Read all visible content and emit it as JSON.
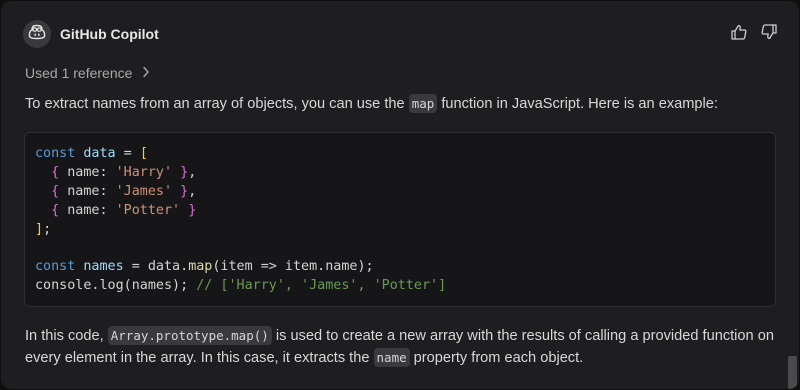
{
  "header": {
    "title": "GitHub Copilot",
    "avatar_icon": "copilot-icon",
    "actions": [
      {
        "name": "thumbs-up-icon"
      },
      {
        "name": "thumbs-down-icon"
      }
    ]
  },
  "reference": {
    "label": "Used 1 reference",
    "icon": "chevron-right-icon"
  },
  "message": {
    "intro_before": "To extract names from an array of objects, you can use the ",
    "intro_code": "map",
    "intro_after": " function in JavaScript. Here is an example:",
    "code": {
      "l1_kw": "const",
      "l1_var": "data",
      "l1_op": " = ",
      "l1_open": "[",
      "l2_open": "{",
      "l2_key": " name: ",
      "l2_str": "'Harry'",
      "l2_close": "}",
      "l2_comma": ",",
      "l3_open": "{",
      "l3_key": " name: ",
      "l3_str": "'James'",
      "l3_close": "}",
      "l3_comma": ",",
      "l4_open": "{",
      "l4_key": " name: ",
      "l4_str": "'Potter'",
      "l4_close": "}",
      "l5_close": "]",
      "l5_semi": ";",
      "l7_kw": "const",
      "l7_var": "names",
      "l7_mid": " = data.",
      "l7_fn": "map",
      "l7_rest": "(item => item.name);",
      "l8_text": "console.log(names); ",
      "l8_comment": "// ['Harry', 'James', 'Potter']"
    },
    "outro_1": "In this code, ",
    "outro_code1": "Array.prototype.map()",
    "outro_2": " is used to create a new array with the results of calling a provided function on every element in the array. In this case, it extracts the ",
    "outro_code2": "name",
    "outro_3": " property from each object."
  },
  "colors": {
    "background": "#1e1e20",
    "code_background": "#161618",
    "keyword": "#569cd6",
    "string": "#ce9178",
    "comment": "#6a9955",
    "bracket_gold": "#ffd700",
    "bracket_purple": "#da70d6"
  }
}
